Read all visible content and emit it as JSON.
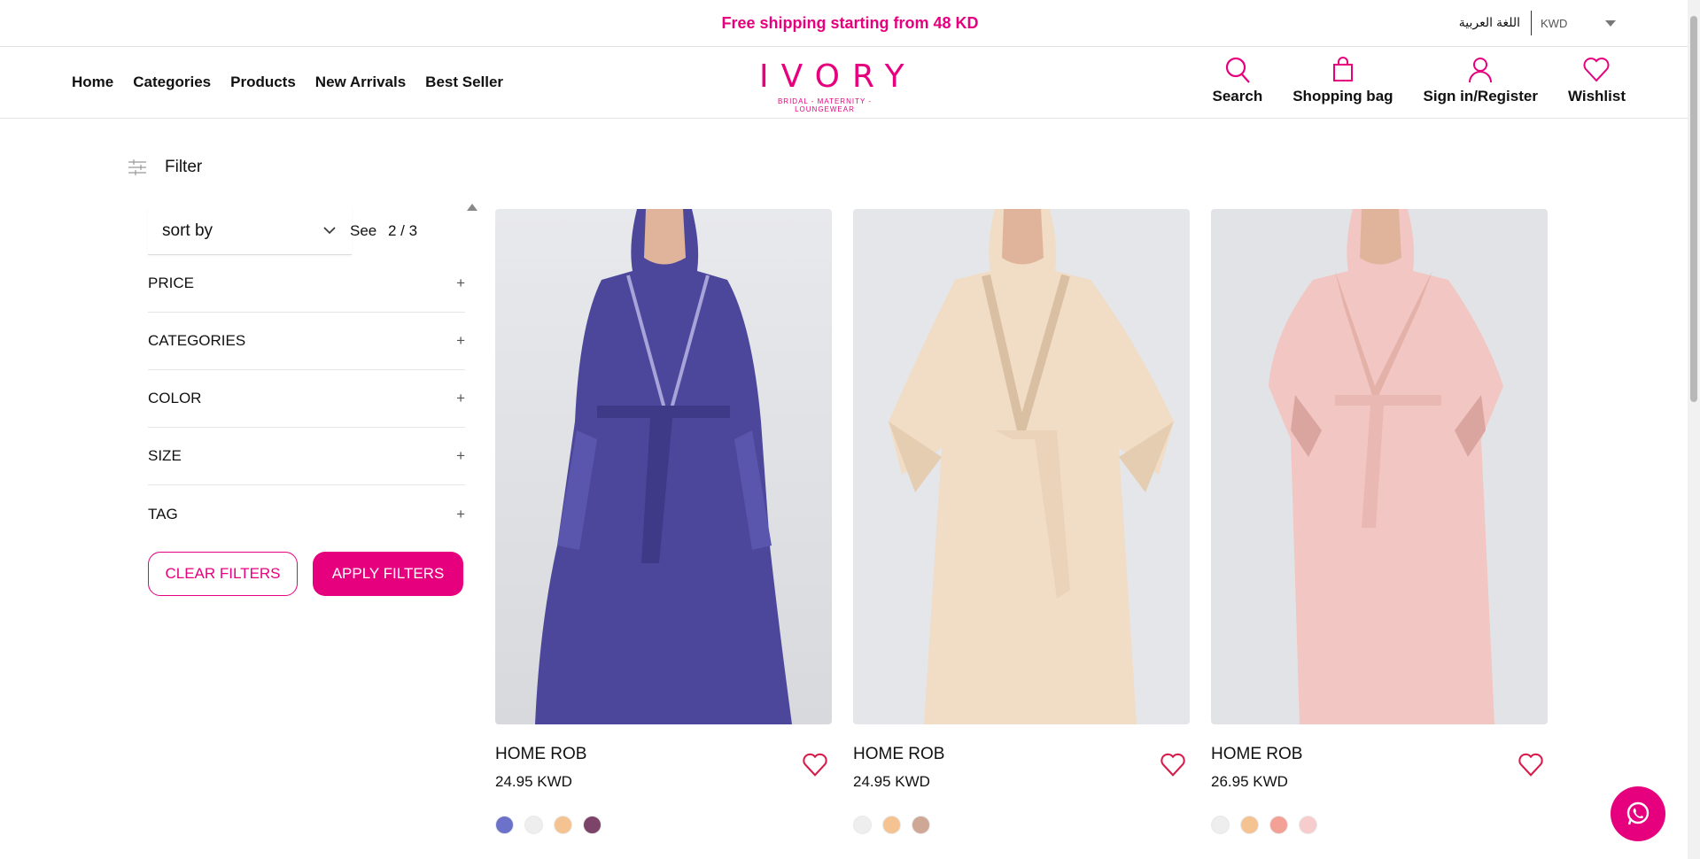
{
  "topbar": {
    "promo": "Free shipping starting from 48 KD",
    "language": "اللغة العربية",
    "currency": "KWD"
  },
  "nav": [
    "Home",
    "Categories",
    "Products",
    "New Arrivals",
    "Best Seller"
  ],
  "logo": {
    "main": "IVORY",
    "sub": "BRIDAL - MATERNITY - LOUNGEWEAR"
  },
  "actions": {
    "search": "Search",
    "bag": "Shopping bag",
    "account": "Sign in/Register",
    "wishlist": "Wishlist"
  },
  "filter": {
    "label": "Filter",
    "sort_placeholder": "sort by",
    "see_label": "See",
    "see_value": "2 / 3",
    "sections": [
      "PRICE",
      "CATEGORIES",
      "COLOR",
      "SIZE",
      "TAG"
    ],
    "clear_label": "CLEAR FILTERS",
    "apply_label": "APPLY FILTERS"
  },
  "products": [
    {
      "name": "HOME ROB",
      "price": "24.95 KWD",
      "robe_color": "#5a55a8",
      "swatches": [
        "#6c72c9",
        "#eeeeee",
        "#f4c391",
        "#7b4468"
      ]
    },
    {
      "name": "HOME ROB",
      "price": "24.95 KWD",
      "robe_color": "#f3ddc6",
      "swatches": [
        "#eeeeee",
        "#f4c391",
        "#cfa797"
      ]
    },
    {
      "name": "HOME ROB",
      "price": "26.95 KWD",
      "robe_color": "#f3c3c0",
      "swatches": [
        "#eeeeee",
        "#f4c391",
        "#f3a097",
        "#f7cccc"
      ]
    }
  ],
  "colors": {
    "accent": "#e6007e"
  }
}
